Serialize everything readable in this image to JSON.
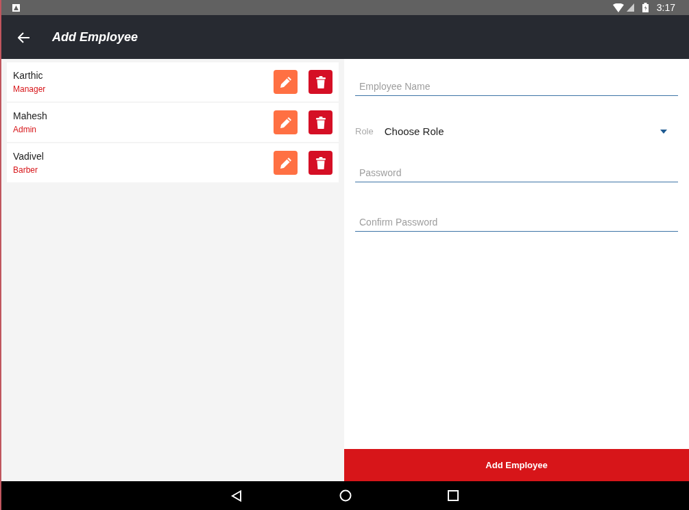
{
  "status_bar": {
    "time": "3:17"
  },
  "app_bar": {
    "title": "Add Employee"
  },
  "employees": [
    {
      "name": "Karthic",
      "role": "Manager"
    },
    {
      "name": "Mahesh",
      "role": "Admin"
    },
    {
      "name": "Vadivel",
      "role": "Barber"
    }
  ],
  "form": {
    "name_field": {
      "placeholder": "Employee Name"
    },
    "role": {
      "label": "Role",
      "value": "Choose Role"
    },
    "password_field": {
      "placeholder": "Password"
    },
    "confirm_field": {
      "placeholder": "Confirm Password"
    },
    "submit": "Add Employee"
  }
}
